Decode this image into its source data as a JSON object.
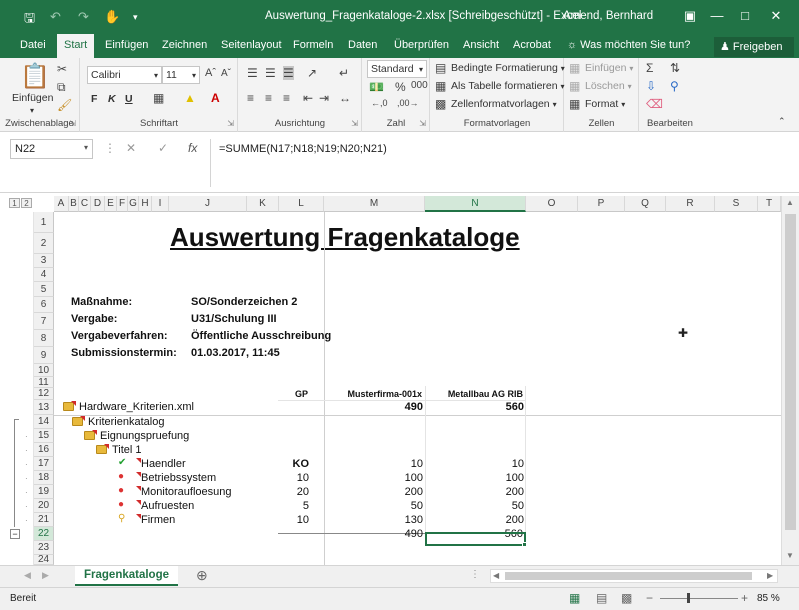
{
  "window": {
    "title": "Auswertung_Fragenkataloge-2.xlsx  [Schreibgeschützt] - Excel",
    "user": "Amend, Bernhard"
  },
  "tabs": [
    "Datei",
    "Start",
    "Einfügen",
    "Zeichnen",
    "Seitenlayout",
    "Formeln",
    "Daten",
    "Überprüfen",
    "Ansicht",
    "Acrobat"
  ],
  "tell_me": "Was möchten Sie tun?",
  "share": "Freigeben",
  "ribbon": {
    "clipboard": {
      "paste": "Einfügen",
      "label": "Zwischenablage"
    },
    "font": {
      "name": "Calibri",
      "size": "11",
      "bold": "F",
      "italic": "K",
      "underline": "U",
      "label": "Schriftart"
    },
    "alignment": {
      "label": "Ausrichtung"
    },
    "number": {
      "format": "Standard",
      "label": "Zahl"
    },
    "styles": {
      "conditional": "Bedingte Formatierung",
      "table": "Als Tabelle formatieren",
      "cell": "Zellenformatvorlagen",
      "label": "Formatvorlagen"
    },
    "cells": {
      "insert": "Einfügen",
      "delete": "Löschen",
      "format": "Format",
      "label": "Zellen"
    },
    "editing": {
      "label": "Bearbeiten"
    }
  },
  "formula_bar": {
    "name_box": "N22",
    "formula": "=SUMME(N17;N18;N19;N20;N21)"
  },
  "grid": {
    "outline_levels": [
      "1",
      "2"
    ],
    "columns": [
      "A",
      "B",
      "C",
      "D",
      "E",
      "F",
      "G",
      "H",
      "I",
      "J",
      "K",
      "L",
      "M",
      "N",
      "O",
      "P",
      "Q",
      "R",
      "S",
      "T"
    ],
    "rows": [
      "1",
      "2",
      "3",
      "4",
      "5",
      "6",
      "7",
      "8",
      "9",
      "10",
      "11",
      "12",
      "13",
      "14",
      "15",
      "16",
      "17",
      "18",
      "19",
      "20",
      "21",
      "22",
      "23",
      "24"
    ],
    "title": "Auswertung Fragenkataloge",
    "info": [
      {
        "label": "Maßnahme:",
        "value": "SO/Sonderzeichen 2"
      },
      {
        "label": "Vergabe:",
        "value": "U31/Schulung III"
      },
      {
        "label": "Vergabeverfahren:",
        "value": "Öffentliche Ausschreibung"
      },
      {
        "label": "Submissionstermin:",
        "value": "01.03.2017, 11:45"
      }
    ],
    "headers": {
      "gp": "GP",
      "bidder1": "Musterfirma-001x",
      "bidder2": "Metallbau AG RIB"
    },
    "tree": [
      {
        "name": "Hardware_Kriterien.xml",
        "gp": "",
        "m": "490",
        "n": "560"
      },
      {
        "name": "Kriterienkatalog",
        "gp": "",
        "m": "",
        "n": ""
      },
      {
        "name": "Eignungspruefung",
        "gp": "",
        "m": "",
        "n": ""
      },
      {
        "name": "Titel 1",
        "gp": "",
        "m": "",
        "n": ""
      },
      {
        "name": "Haendler",
        "gp": "KO",
        "m": "10",
        "n": "10"
      },
      {
        "name": "Betriebssystem",
        "gp": "10",
        "m": "100",
        "n": "100"
      },
      {
        "name": "Monitoraufloesung",
        "gp": "20",
        "m": "200",
        "n": "200"
      },
      {
        "name": "Aufruesten",
        "gp": "5",
        "m": "50",
        "n": "50"
      },
      {
        "name": "Firmen",
        "gp": "10",
        "m": "130",
        "n": "200"
      }
    ],
    "totals": {
      "m": "490",
      "n": "560"
    }
  },
  "sheet_tab": "Fragenkataloge",
  "status": {
    "mode": "Bereit",
    "zoom": "85 %"
  }
}
